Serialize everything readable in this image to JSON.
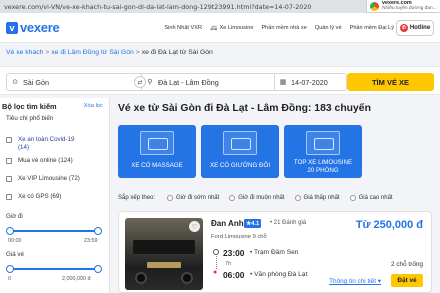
{
  "browser": {
    "url": "vexere.com/vi-VN/ve-xe-khach-tu-sai-gon-di-da-lat-lam-dong-129t23991.html?date=14-07-2020",
    "notification": {
      "title": "vexere.com",
      "subtitle": "Nhiều tuyến đường đan..."
    }
  },
  "header": {
    "logo": "vexere",
    "nav": [
      "Sinh Nhật VXR",
      "Xe Limousine",
      "Phần mềm nhà xe",
      "Quản lý vé",
      "Phần mềm Đại Lý"
    ],
    "lang": "EN",
    "hotline": "Hotline"
  },
  "breadcrumb": [
    "Vé xe khách",
    "xe đi Lâm Đồng từ Sài Gòn",
    "xe đi Đà Lạt từ Sài Gòn"
  ],
  "search": {
    "from": "Sài Gòn",
    "to": "Đà Lạt - Lâm Đồng",
    "date": "14-07-2020",
    "button": "TÌM VÉ XE"
  },
  "sidebar": {
    "title": "Bộ lọc tìm kiếm",
    "clear": "Xóa lọc",
    "subtitle": "Tiêu chí phổ biến",
    "criteria": [
      {
        "label": "Xe an toàn Covid-19",
        "count": "(14)",
        "highlight": true
      },
      {
        "label": "Mua vé online",
        "count": "(124)",
        "highlight": false
      },
      {
        "label": "Xe VIP Limousine",
        "count": "(72)",
        "highlight": false
      },
      {
        "label": "Xe có GPS",
        "count": "(69)",
        "highlight": false
      }
    ],
    "time_label": "Giờ đi",
    "time_min": "00:00",
    "time_max": "23:59",
    "price_label": "Giá vé",
    "price_min": "0",
    "price_max": "2,000,000 đ"
  },
  "main": {
    "title": "Vé xe từ Sài Gòn đi Đà Lạt - Lâm Đồng: 183 chuyến",
    "tiles": [
      {
        "line1": "XE CÓ MASSAGE",
        "line2": ""
      },
      {
        "line1": "XE CÓ GIƯỜNG ĐÔI",
        "line2": ""
      },
      {
        "line1": "TOP XE LIMOUSINE",
        "line2": "20 PHÒNG"
      }
    ],
    "sort_label": "Sắp xếp theo:",
    "sort_options": [
      "Giờ đi sớm nhất",
      "Giờ đi muộn nhất",
      "Giá thấp nhất",
      "Giá cao nhất"
    ]
  },
  "result": {
    "operator": "Đan Anh",
    "rating": "★4.1",
    "reviews": "• 21 Đánh giá",
    "vehicle": "Ford Limousine 9 chỗ",
    "price": "Từ 250,000 đ",
    "depart_time": "23:00",
    "depart_place": "• Trạm Đầm Sen",
    "duration": "7h",
    "arrive_time": "06:00",
    "arrive_place": "• Văn phòng Đà Lạt",
    "seats": "2 chỗ trống",
    "details": "Thông tin chi tiết",
    "book": "Đặt vé"
  }
}
